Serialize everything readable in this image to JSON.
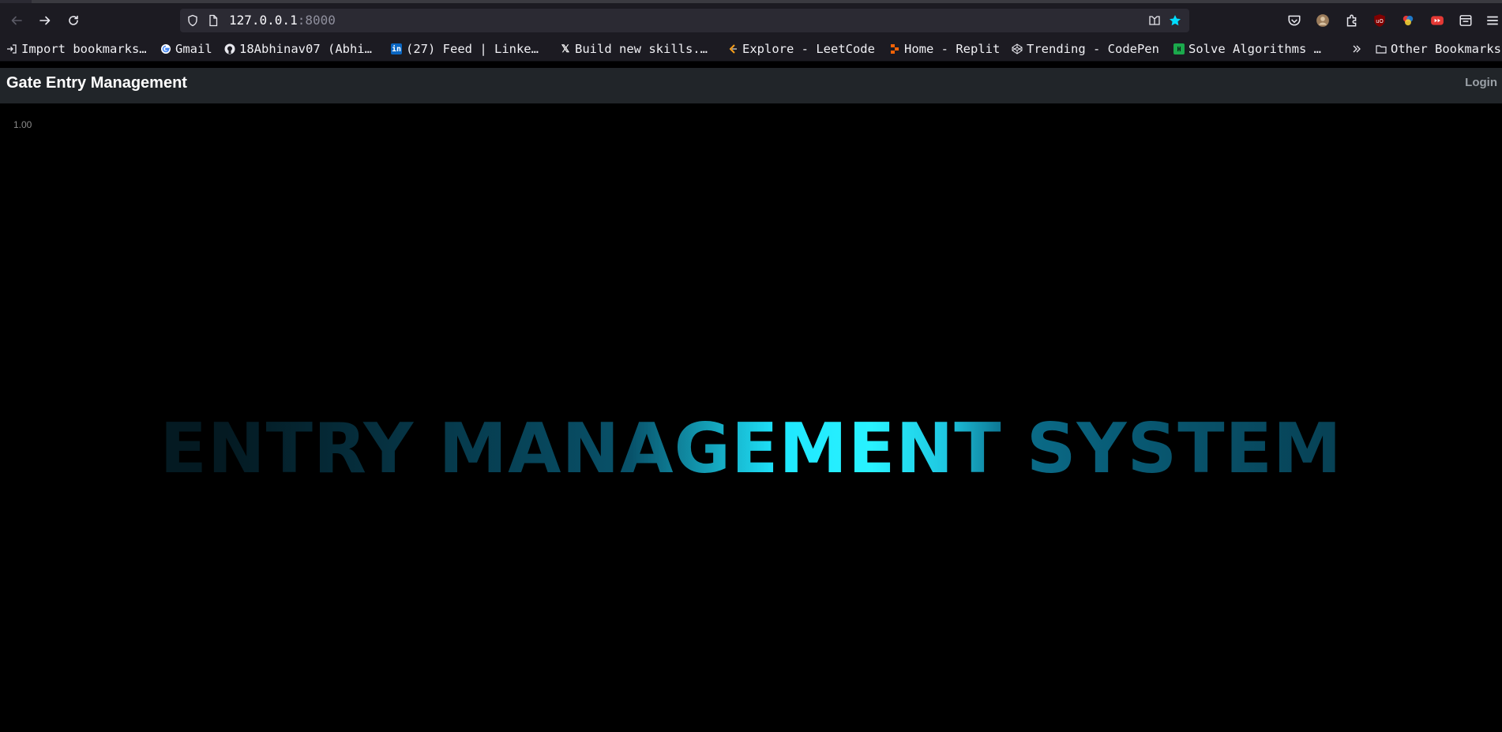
{
  "browser": {
    "url_host": "127.0.0.1",
    "url_port": ":8000",
    "bookmarks": [
      {
        "label": "Import bookmarks…",
        "icon": "import-icon"
      },
      {
        "label": "Gmail",
        "icon": "google-icon"
      },
      {
        "label": "18Abhinav07 (Abhi…",
        "icon": "github-icon"
      },
      {
        "label": "(27) Feed | Linke…",
        "icon": "linkedin-icon"
      },
      {
        "label": "Build new skills.…",
        "icon": "x-icon"
      },
      {
        "label": "Explore - LeetCode",
        "icon": "leetcode-icon"
      },
      {
        "label": "Home - Replit",
        "icon": "replit-icon"
      },
      {
        "label": "Trending - CodePen",
        "icon": "codepen-icon"
      },
      {
        "label": "Solve Algorithms …",
        "icon": "hackerrank-icon"
      }
    ],
    "other_bookmarks": "Other Bookmarks",
    "accent": "#00ddff"
  },
  "app": {
    "brand": "Gate Entry Management",
    "login": "Login",
    "scale_label": "1.00",
    "hero_text": "ENTRY MANAGEMENT SYSTEM",
    "hero_highlight_color": "#29f2ff",
    "hero_dim_color": "#041a22"
  }
}
